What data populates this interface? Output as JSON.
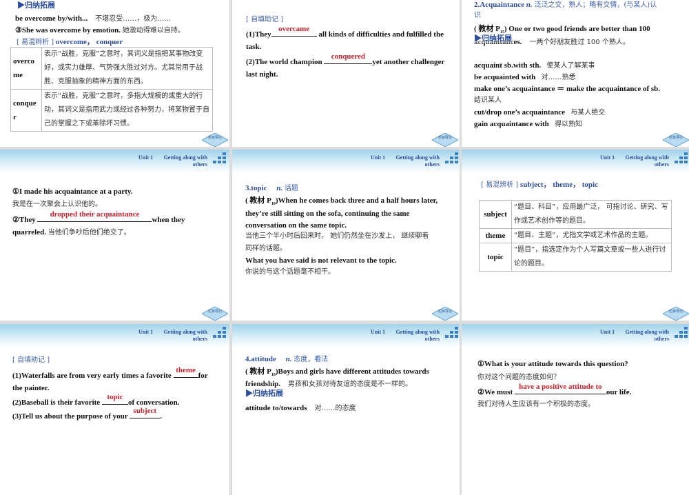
{
  "header": {
    "unit": "Unit 1",
    "title_line1": "Getting along with",
    "title_line2": "others"
  },
  "nav_label": "栏目导引",
  "slide1": {
    "heading": "▶归纳拓展",
    "phrase_en": "be overcome by/with...",
    "phrase_cn": "不堪忍受……，极为……",
    "ex3_en": "③She was overcome by emotion.",
    "ex3_cn": "她激动得难以自持。",
    "compare_tag": "[ 易混辨析 ]",
    "compare_words": "overcome， conquer",
    "table": [
      {
        "word": "overcome",
        "desc": "表示“战胜，克服”之意时，其词义是指把某事物改变好，或实力雄厚、气势强大胜过对方。尤其常用于战胜、克服抽象的精神方面的东西。"
      },
      {
        "word": "conquer",
        "desc": "表示“战胜，克服”之意时，多指大规模的或重大的行动，其词义是指用武力或经过各种努力，将某物置于自己的掌握之下或革除坏习惯。"
      }
    ]
  },
  "slide2": {
    "tag": "[ 自填助记 ]",
    "q1_pre": "(1)They",
    "q1_answer": "overcame",
    "q1_post": " all kinds of difficulties and fulfilled the",
    "q1_cont": "task.",
    "q2_pre": "(2)The world champion ",
    "q2_answer": "conquered",
    "q2_post": "yet another challenger",
    "q2_cont": "last night."
  },
  "slide3": {
    "word": "2.Acquaintance",
    "pos": "n.",
    "meaning": "泛泛之交，熟人；略有交情，(与某人)认",
    "meaning_cont": "识",
    "source_pre": "( 教材 P",
    "source_page": "15",
    "source_en": ") One or two good friends are better than 100",
    "source_cont": "acquaintances.",
    "source_cn": "一两个好朋友胜过 100 个熟人。",
    "heading": "▶归纳拓展",
    "phrases": [
      {
        "en": "acquaint sb.with sth.",
        "cn": "使某人了解某事"
      },
      {
        "en": "be acquainted with",
        "cn": "对……熟悉"
      },
      {
        "en": "make one’s acquaintance ＝ make the acquaintance of sb.",
        "cn": ""
      },
      {
        "en": "",
        "cn": "结识某人"
      },
      {
        "en": "cut/drop one’s acquaintance",
        "cn": "与某人绝交"
      },
      {
        "en": "gain acquaintance with",
        "cn": "得以熟知"
      }
    ]
  },
  "slide4": {
    "ex1_en": "①I made his acquaintance at a party.",
    "ex1_cn": "我是在一次聚会上认识他的。",
    "ex2_pre": "②They ",
    "ex2_answer": "dropped their acquaintance",
    "ex2_post": "when they",
    "ex2_cont": "quarreled.",
    "ex2_cn": "当他们争吵后他们绝交了。"
  },
  "slide5": {
    "word": "3.topic",
    "pos": "n.",
    "meaning": "话题",
    "source_pre": "( 教材 P",
    "source_page": "18",
    "source_en": ")When he comes back three and a half hours later,",
    "source_l2": "they’re still sitting on the sofa, continuing the same",
    "source_l3": "conversation on the same topic.",
    "source_cn1": "当他三个半小时后回来时， 她们仍然坐在沙发上， 继续聊着",
    "source_cn2": "同样的话题。",
    "ex_en": "What you have said is not relevant to the topic.",
    "ex_cn": "你说的与这个话题毫不相干。"
  },
  "slide6": {
    "compare_tag": "[ 易混辨析 ]",
    "compare_words": "subject， theme， topic",
    "table": [
      {
        "word": "subject",
        "desc": "“题目、科目”，应用最广泛， 可指讨论、研究、写作或艺术创作等的题目。"
      },
      {
        "word": "theme",
        "desc": "“题目、主题”，尤指文学或艺术作品的主题。"
      },
      {
        "word": "topic",
        "desc": "“题目”，指选定作为个人写篇文章或一些人进行讨论的题目。"
      }
    ]
  },
  "slide7": {
    "tag": "[ 自填助记 ]",
    "q1_pre": "(1)Waterfalls are from very early times a favorite ",
    "q1_answer": "theme",
    "q1_post": "for",
    "q1_cont": "the painter.",
    "q2_pre": "(2)Baseball is their favorite ",
    "q2_answer": "topic",
    "q2_post": "of conversation.",
    "q3_pre": "(3)Tell us about the purpose of your ",
    "q3_answer": "subject",
    "q3_post": "."
  },
  "slide8": {
    "word": "4.attitude",
    "pos": "n.",
    "meaning": "态度，看法",
    "source_pre": "( 教材 P",
    "source_page": "18",
    "source_en": ")Boys and girls have different attitudes towards",
    "source_cont": "friendship.",
    "source_cn": "男孩和女孩对待友谊的态度是不一样的。",
    "heading": "▶归纳拓展",
    "phrase_en": "attitude to/towards",
    "phrase_cn": "对……的态度"
  },
  "slide9": {
    "ex1_en": "①What is your attitude towards this question?",
    "ex1_cn": "你对这个问题的态度如何？",
    "ex2_pre": "②We must ",
    "ex2_answer": "have a positive attitude to",
    "ex2_post": "our life.",
    "ex2_cn": "我们对待人生应该有一个积极的态度。"
  }
}
